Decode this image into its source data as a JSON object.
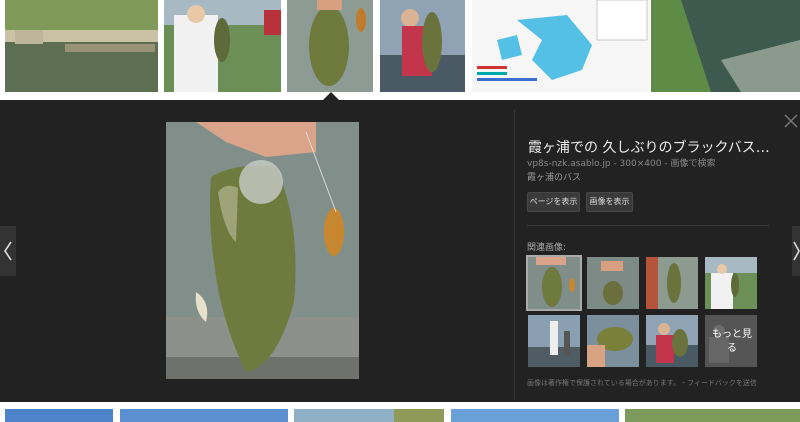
{
  "detail": {
    "title": "霞ヶ浦での 久しぶりのブラックバス: 雨...",
    "site": "vp8s-nzk.asablo.jp",
    "size": "300×400",
    "search_by_image": "画像で検索",
    "description": "霞ヶ浦のバス",
    "view_page_label": "ページを表示",
    "view_image_label": "画像を表示",
    "related_label": "関連画像:",
    "more_label": "もっと見る",
    "footer": "画像は著作権で保護されている場合があります。 - フィードバックを送信"
  },
  "icons": {
    "close": "close-icon",
    "prev": "chevron-left-icon",
    "next": "chevron-right-icon"
  },
  "colors": {
    "panel_bg": "#222222",
    "panel_text": "#eeeeee",
    "muted_text": "#8a8a8a",
    "button_bg": "#3a3a3a"
  }
}
